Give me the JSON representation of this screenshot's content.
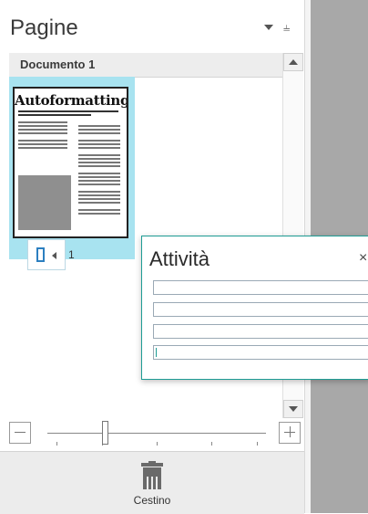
{
  "pane": {
    "title": "Pagine"
  },
  "document": {
    "group_label": "Documento 1"
  },
  "thumbnail": {
    "page_number": "1",
    "preview_heading": "Autoformatting"
  },
  "tasks": {
    "title": "Attività",
    "close_glyph": "×"
  },
  "trash": {
    "label": "Cestino"
  },
  "icons": {
    "pane_menu": "chevron-down-icon",
    "pin": "pin-icon",
    "scroll_up": "arrow-up-icon",
    "scroll_down": "arrow-down-icon",
    "page_action": "page-icon",
    "zoom_out": "minus-icon",
    "zoom_in": "plus-icon",
    "trash": "trash-icon"
  },
  "colors": {
    "selection": "#a8e3f0",
    "accent": "#1e9c94",
    "page_icon": "#2c7fc0"
  }
}
